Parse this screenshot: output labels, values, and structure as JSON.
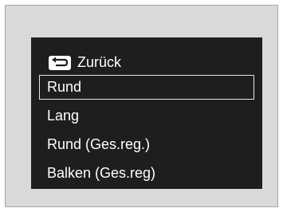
{
  "menu": {
    "back_icon": "return-arrow-icon",
    "back_label": "Zurück",
    "items": [
      {
        "label": "Rund",
        "selected": true
      },
      {
        "label": "Lang",
        "selected": false
      },
      {
        "label": "Rund (Ges.reg.)",
        "selected": false
      },
      {
        "label": "Balken (Ges.reg)",
        "selected": false
      }
    ]
  },
  "colors": {
    "screen_background": "#1e1e1e",
    "frame_background": "#d9d9d9",
    "text": "#ffffff"
  }
}
